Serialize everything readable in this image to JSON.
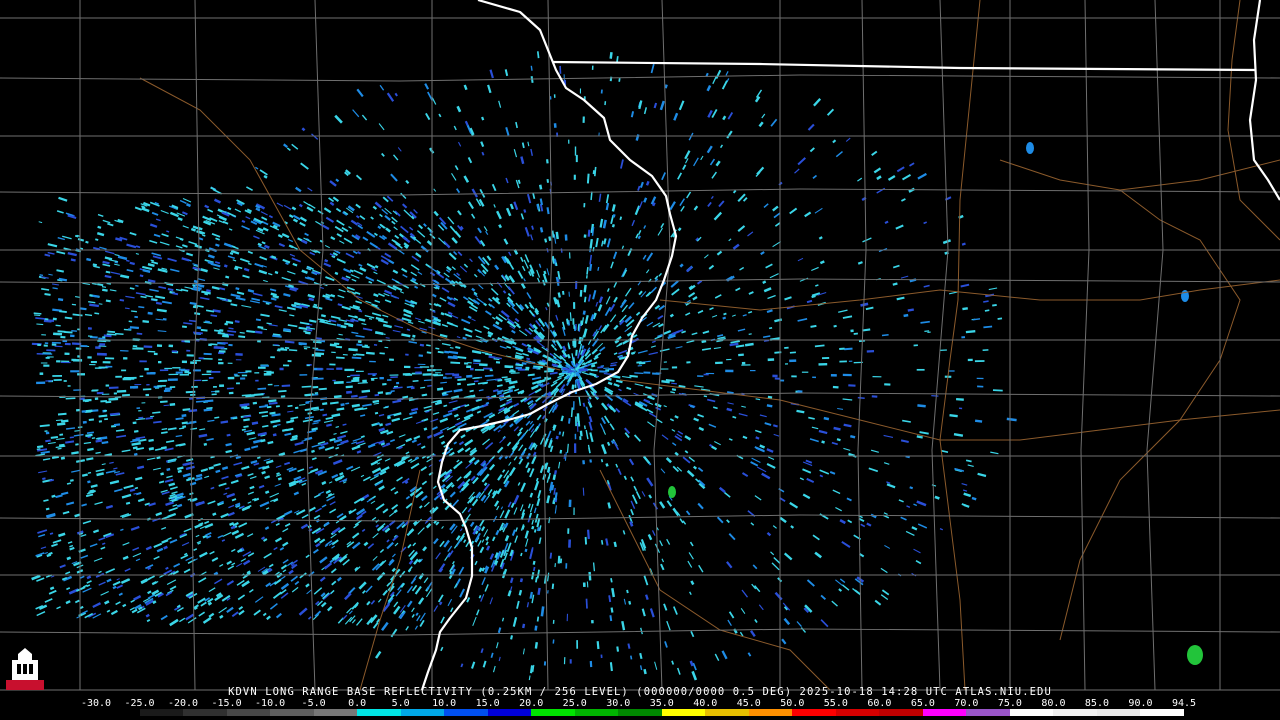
{
  "product": {
    "caption": "KDVN LONG RANGE BASE REFLECTIVITY (0.25KM / 256 LEVEL) (000000/0000 0.5 DEG) 2025-10-18 14:28 UTC  ATLAS.NIU.EDU"
  },
  "logo": {
    "text": "NIU",
    "color": "#c8102e"
  },
  "scale": {
    "ticks": [
      "-30.0",
      "-25.0",
      "-20.0",
      "-15.0",
      "-10.0",
      "-5.0",
      "0.0",
      "5.0",
      "10.0",
      "15.0",
      "20.0",
      "25.0",
      "30.0",
      "35.0",
      "40.0",
      "45.0",
      "50.0",
      "55.0",
      "60.0",
      "65.0",
      "70.0",
      "75.0",
      "80.0",
      "85.0",
      "90.0",
      "94.5"
    ],
    "colors": [
      "#000000",
      "#1a1a1a",
      "#303030",
      "#474747",
      "#5e5e5e",
      "#777777",
      "#00e5e5",
      "#00a8e8",
      "#0050f0",
      "#0000d8",
      "#00e400",
      "#00b400",
      "#008800",
      "#ffff00",
      "#e7c000",
      "#ff9000",
      "#ff0000",
      "#d60000",
      "#c00000",
      "#ff00ff",
      "#9955c9",
      "#ffffff",
      "#f0f0f0",
      "#e8e8e8",
      "#ffffff"
    ]
  },
  "colors": {
    "background": "#000000",
    "county_lines": "#6f6f6f",
    "state_lines": "#ffffff",
    "roads": "#8b5a2b",
    "echo_light": "#3ad6e8",
    "echo_mid": "#1e8ce6",
    "echo_dark": "#2a4fd9",
    "echo_green": "#22c43a"
  }
}
